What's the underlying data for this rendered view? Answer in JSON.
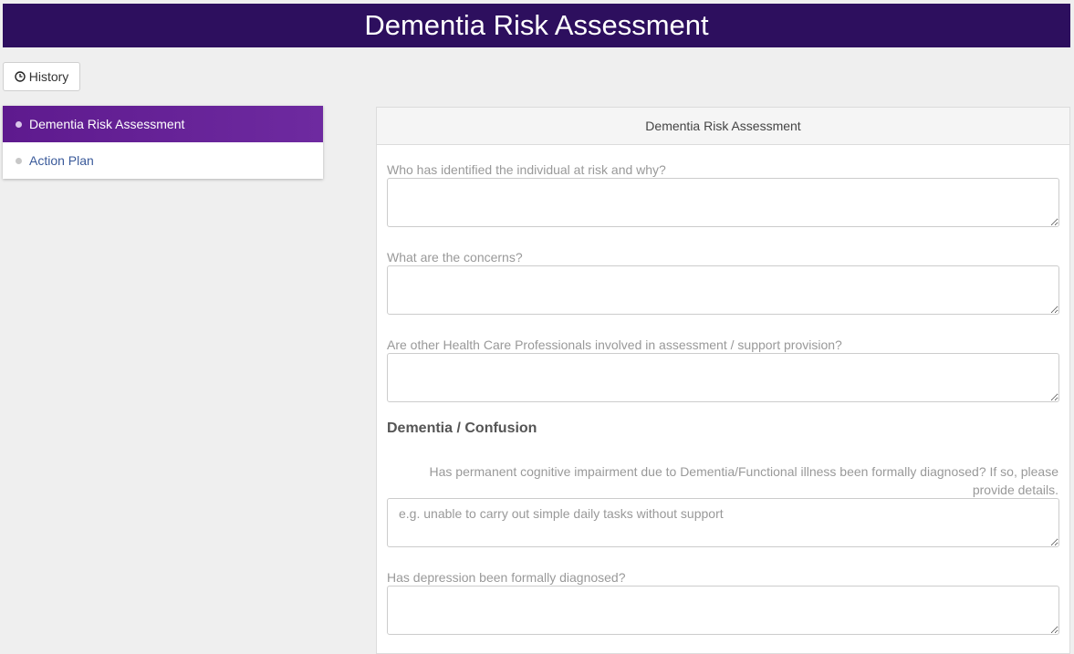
{
  "header": {
    "title": "Dementia Risk Assessment"
  },
  "toolbar": {
    "history_label": "History",
    "history_icon": "clock-icon"
  },
  "sidebar": {
    "items": [
      {
        "label": "Dementia Risk Assessment",
        "active": true
      },
      {
        "label": "Action Plan",
        "active": false
      }
    ]
  },
  "panel": {
    "title": "Dementia Risk Assessment",
    "fields": [
      {
        "label": "Who has identified the individual at risk and why?",
        "value": "",
        "placeholder": ""
      },
      {
        "label": "What are the concerns?",
        "value": "",
        "placeholder": ""
      },
      {
        "label": "Are other Health Care Professionals involved in assessment / support provision?",
        "value": "",
        "placeholder": ""
      }
    ],
    "section_heading": "Dementia / Confusion",
    "section_fields": [
      {
        "label": "Has permanent cognitive impairment due to Dementia/Functional illness been formally diagnosed? If so, please provide details.",
        "value": "",
        "placeholder": "e.g. unable to carry out simple daily tasks without support"
      },
      {
        "label": "Has depression been formally diagnosed?",
        "value": "",
        "placeholder": ""
      }
    ]
  },
  "colors": {
    "title_bar": "#2d0f5e",
    "active_nav": "#5e1a8e",
    "link": "#3a5a9a",
    "background": "#efefef"
  }
}
